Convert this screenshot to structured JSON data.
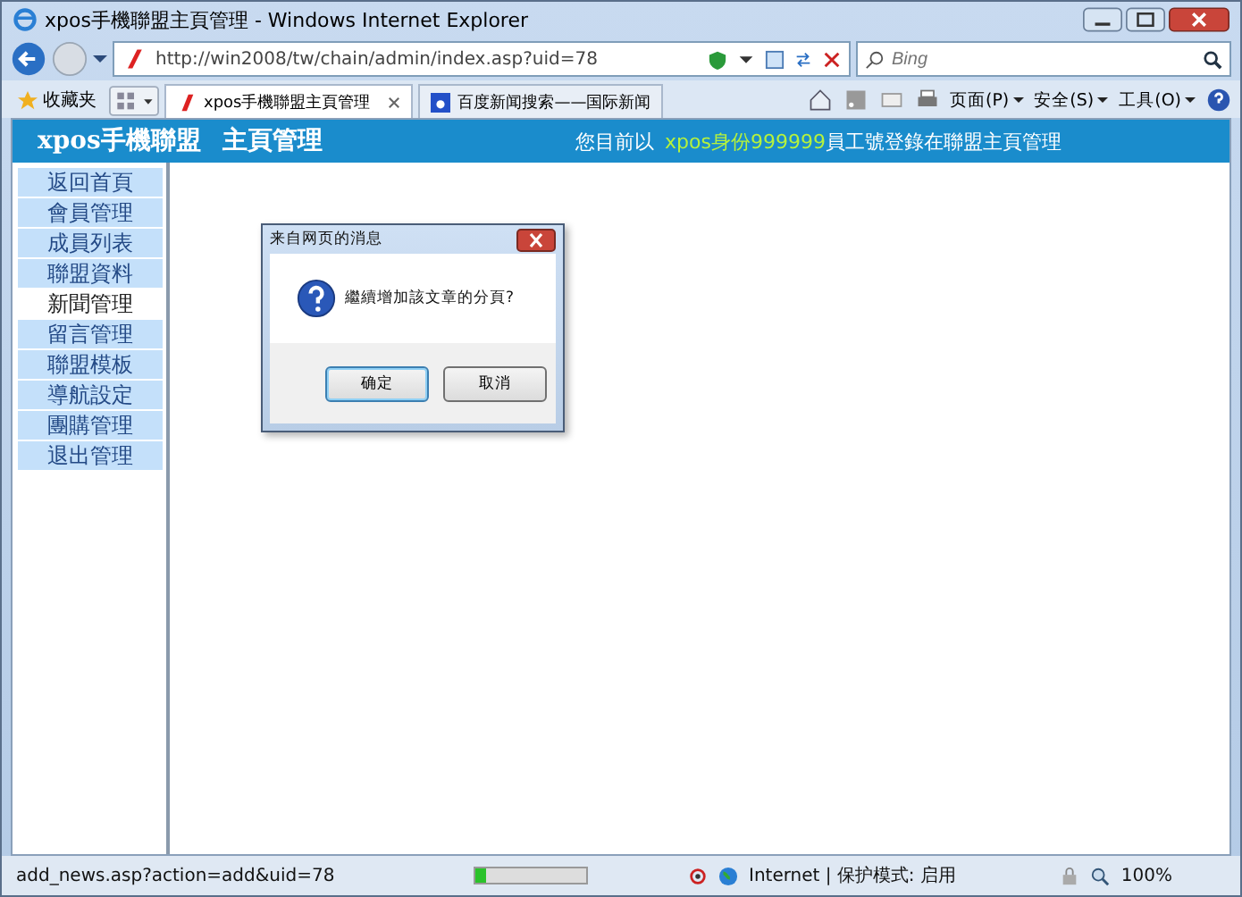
{
  "window": {
    "title": "xpos手機聯盟主頁管理 - Windows Internet Explorer"
  },
  "address": {
    "url": "http://win2008/tw/chain/admin/index.asp?uid=78",
    "search_placeholder": "Bing"
  },
  "toolbar": {
    "favorites": "收藏夹",
    "tabs": [
      {
        "label": "xpos手機聯盟主頁管理",
        "selected": true
      },
      {
        "label": "百度新闻搜索——国际新闻",
        "selected": false
      }
    ],
    "commands": [
      "页面(P)",
      "安全(S)",
      "工具(O)"
    ]
  },
  "page": {
    "header": {
      "brand": "xpos手機聯盟",
      "title": "主頁管理",
      "login_prefix": "您目前以",
      "login_highlight": "xpos身份999999",
      "login_suffix": "員工號登錄在聯盟主頁管理"
    },
    "sidebar": [
      {
        "label": "返回首頁",
        "selected": false
      },
      {
        "label": "會員管理",
        "selected": false
      },
      {
        "label": "成員列表",
        "selected": false
      },
      {
        "label": "聯盟資料",
        "selected": false
      },
      {
        "label": "新聞管理",
        "selected": true
      },
      {
        "label": "留言管理",
        "selected": false
      },
      {
        "label": "聯盟模板",
        "selected": false
      },
      {
        "label": "導航設定",
        "selected": false
      },
      {
        "label": "團購管理",
        "selected": false
      },
      {
        "label": "退出管理",
        "selected": false
      }
    ]
  },
  "dialog": {
    "title": "来自网页的消息",
    "message": "繼續增加該文章的分頁?",
    "buttons": [
      {
        "label": "确定",
        "default": true
      },
      {
        "label": "取消",
        "default": false
      }
    ]
  },
  "status_bar": {
    "url": "add_news.asp?action=add&uid=78",
    "progress": {
      "level": 0.1
    },
    "zone": "Internet | 保护模式: 启用",
    "zoom": "100%"
  }
}
